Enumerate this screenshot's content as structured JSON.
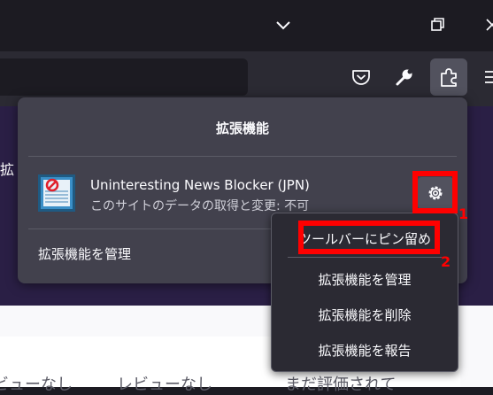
{
  "panel": {
    "title": "拡張機能",
    "extension": {
      "name": "Uninteresting News Blocker (JPN)",
      "status": "このサイトのデータの取得と変更: 不可"
    },
    "manage_link": "拡張機能を管理"
  },
  "context_menu": {
    "items": [
      "ツールバーにピン留め",
      "拡張機能を管理",
      "拡張機能を削除",
      "拡張機能を報告"
    ]
  },
  "annotations": {
    "label_1": "1",
    "label_2": "2",
    "color": "#ff0000"
  },
  "page": {
    "edge_text": "拡",
    "bottom_texts": [
      "ビューなし",
      "レビューなし",
      "まだ評価されて"
    ]
  },
  "icons": {
    "window": [
      "chevron-down-icon",
      "restore-icon",
      "close-icon"
    ],
    "toolbar": [
      "pocket-icon",
      "wrench-icon",
      "extensions-icon",
      "menu-icon"
    ],
    "extension": "settings-gear-icon"
  },
  "colors": {
    "panel_bg": "#42414d",
    "menu_bg": "#2b2a33",
    "accent_red": "#ff0000",
    "page_purple": "#2a1f45"
  }
}
